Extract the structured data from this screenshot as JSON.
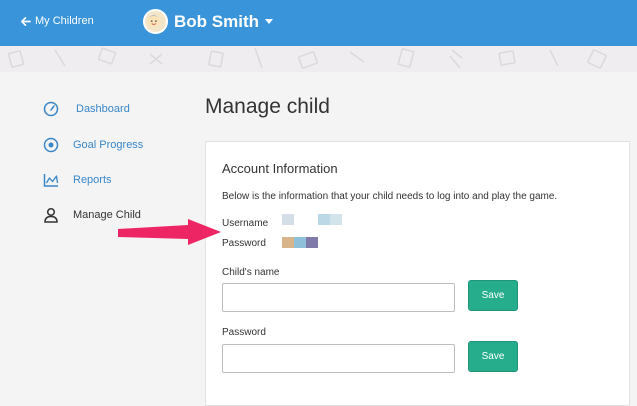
{
  "header": {
    "back_label": "My Children",
    "user_name": "Bob Smith"
  },
  "sidebar": {
    "items": [
      {
        "label": "Dashboard",
        "icon": "gauge-icon"
      },
      {
        "label": "Goal Progress",
        "icon": "target-icon"
      },
      {
        "label": "Reports",
        "icon": "chart-icon"
      },
      {
        "label": "Manage Child",
        "icon": "person-icon"
      }
    ]
  },
  "main": {
    "title": "Manage child",
    "account": {
      "section_title": "Account Information",
      "description": "Below is the information that your child needs to log into and play the game.",
      "username_label": "Username",
      "password_label": "Password"
    },
    "child_name_label": "Child's name",
    "password_field_label": "Password",
    "save_label": "Save"
  },
  "colors": {
    "header_blue": "#3a94d9",
    "link_blue": "#3a86c8",
    "save_green": "#26ae8c",
    "annotation_arrow": "#ee2565"
  }
}
